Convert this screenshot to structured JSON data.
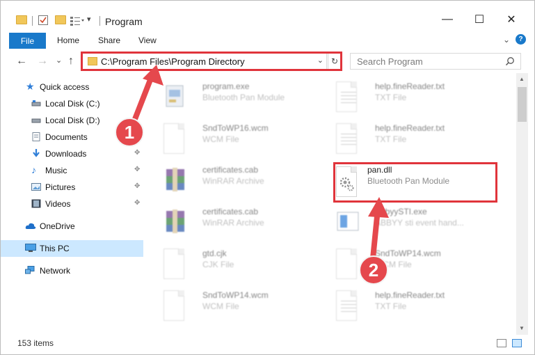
{
  "window": {
    "title": "Program",
    "controls": {
      "minimize": "—",
      "maximize": "☐",
      "close": "✕"
    }
  },
  "ribbon": {
    "tabs": [
      "File",
      "Home",
      "Share",
      "View"
    ],
    "expand_glyph": "⌄",
    "help_glyph": "?"
  },
  "nav": {
    "back": "←",
    "forward": "→",
    "recent": "⌄",
    "up": "↑",
    "address": "C:\\Program Files\\Program Directory",
    "search_placeholder": "Search Program",
    "refresh_glyph": "↻"
  },
  "sidebar": {
    "items": [
      {
        "label": "Quick access",
        "icon": "star-icon"
      },
      {
        "label": "Local Disk (C:)",
        "icon": "drive-icon"
      },
      {
        "label": "Local Disk (D:)",
        "icon": "drive-icon"
      },
      {
        "label": "Documents",
        "icon": "documents-icon"
      },
      {
        "label": "Downloads",
        "icon": "download-icon"
      },
      {
        "label": "Music",
        "icon": "music-icon"
      },
      {
        "label": "Pictures",
        "icon": "pictures-icon"
      },
      {
        "label": "Videos",
        "icon": "videos-icon"
      },
      {
        "label": "OneDrive",
        "icon": "cloud-icon"
      },
      {
        "label": "This PC",
        "icon": "computer-icon"
      },
      {
        "label": "Network",
        "icon": "network-icon"
      }
    ],
    "pin_glyph": "📌"
  },
  "files": [
    {
      "name": "program.exe",
      "type": "Bluetooth Pan Module",
      "icon": "exe-icon"
    },
    {
      "name": "help.fineReader.txt",
      "type": "TXT File",
      "icon": "txt-icon"
    },
    {
      "name": "SndToWP16.wcm",
      "type": "WCM File",
      "icon": "blank-file-icon"
    },
    {
      "name": "help.fineReader.txt",
      "type": "TXT File",
      "icon": "txt-icon"
    },
    {
      "name": "certificates.cab",
      "type": "WinRAR Archive",
      "icon": "winrar-icon"
    },
    {
      "name": "pan.dll",
      "type": "Bluetooth Pan Module",
      "icon": "dll-gear-icon"
    },
    {
      "name": "certificates.cab",
      "type": "WinRAR Archive",
      "icon": "winrar-icon"
    },
    {
      "name": "AbbyySTI.exe",
      "type": "ABBYY sti event hand...",
      "icon": "app-icon"
    },
    {
      "name": "gtd.cjk",
      "type": "CJK File",
      "icon": "blank-file-icon"
    },
    {
      "name": "SndToWP14.wcm",
      "type": "WCM File",
      "icon": "blank-file-icon"
    },
    {
      "name": "SndToWP14.wcm",
      "type": "WCM File",
      "icon": "blank-file-icon"
    },
    {
      "name": "help.fineReader.txt",
      "type": "TXT File",
      "icon": "txt-icon"
    }
  ],
  "status": {
    "count": "153 items"
  },
  "annotations": {
    "step1": "1",
    "step2": "2"
  },
  "colors": {
    "accent": "#1979ca",
    "highlight": "#e0343b",
    "selection": "#cce8ff"
  }
}
